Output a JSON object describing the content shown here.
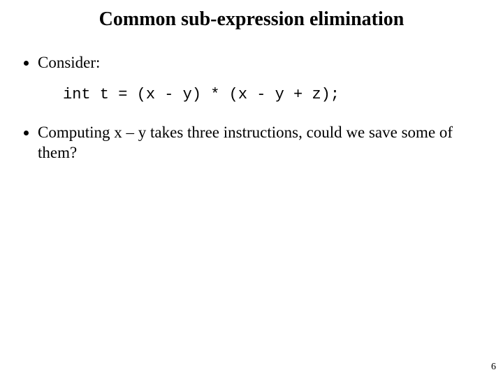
{
  "title": "Common sub-expression elimination",
  "bullets": {
    "first": "Consider:",
    "second": "Computing x – y takes three instructions, could we save some of them?"
  },
  "code_line": "int t = (x - y) * (x - y + z);",
  "page_number": "6"
}
